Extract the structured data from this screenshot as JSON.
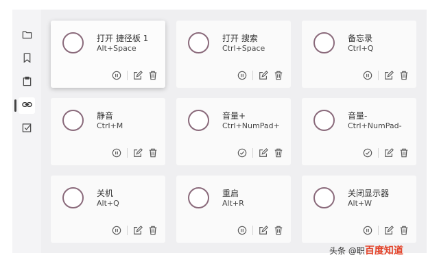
{
  "sidebar": {
    "items": [
      {
        "icon": "folder-icon",
        "active": false
      },
      {
        "icon": "bookmark-icon",
        "active": false
      },
      {
        "icon": "clipboard-icon",
        "active": false
      },
      {
        "icon": "link-icon",
        "active": true
      },
      {
        "icon": "checkbox-icon",
        "active": false
      }
    ]
  },
  "cards": [
    {
      "title": "打开 捷径板 1",
      "hotkey": "Alt+Space",
      "status_icon": "pause-icon",
      "raised": true
    },
    {
      "title": "打开 搜索",
      "hotkey": "Ctrl+Space",
      "status_icon": "pause-icon"
    },
    {
      "title": "备忘录",
      "hotkey": "Ctrl+Q",
      "status_icon": "pause-icon"
    },
    {
      "title": "静音",
      "hotkey": "Ctrl+M",
      "status_icon": "pause-icon"
    },
    {
      "title": "音量+",
      "hotkey": "Ctrl+NumPad+",
      "status_icon": "check-circle-icon"
    },
    {
      "title": "音量-",
      "hotkey": "Ctrl+NumPad-",
      "status_icon": "check-circle-icon"
    },
    {
      "title": "关机",
      "hotkey": "Alt+Q",
      "status_icon": "pause-icon"
    },
    {
      "title": "重启",
      "hotkey": "Alt+R",
      "status_icon": "pause-icon"
    },
    {
      "title": "关闭显示器",
      "hotkey": "Alt+W",
      "status_icon": "pause-icon"
    }
  ],
  "watermark": {
    "prefix": "头条 @职",
    "brand": "百度知道"
  },
  "colors": {
    "accent_ring": "#8a6a7b",
    "background": "#efeff1",
    "card": "#fafafa"
  }
}
